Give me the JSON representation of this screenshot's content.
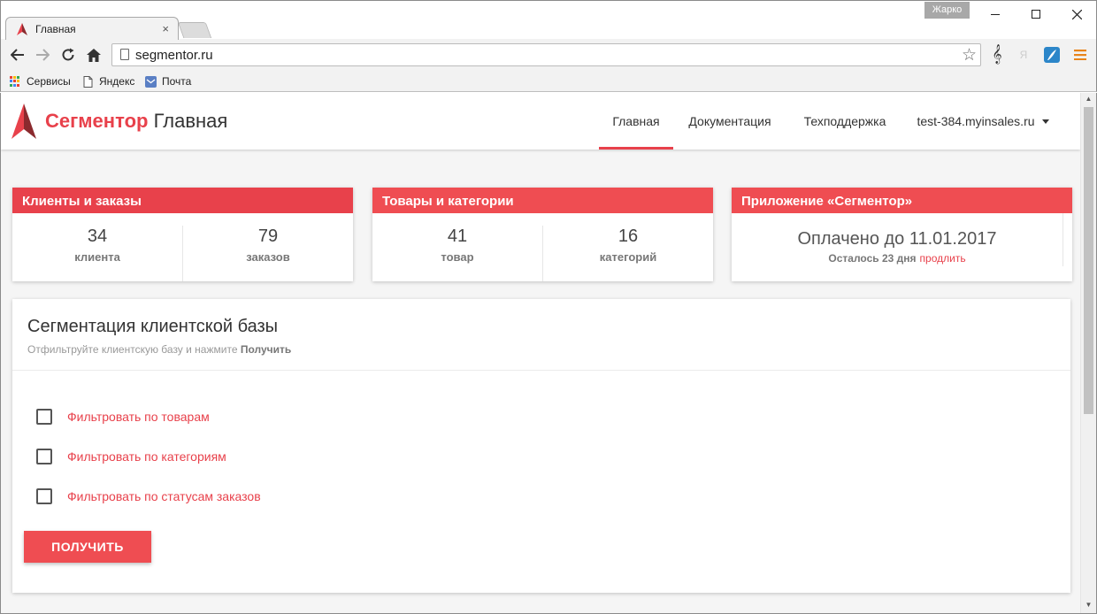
{
  "window": {
    "user_badge": "Жарко"
  },
  "tab": {
    "title": "Главная",
    "close_glyph": "×"
  },
  "omnibox": {
    "url": "segmentor.ru"
  },
  "bookmarks": [
    {
      "label": "Сервисы",
      "icon": "apps-icon"
    },
    {
      "label": "Яндекс",
      "icon": "page-icon"
    },
    {
      "label": "Почта",
      "icon": "mail-icon"
    }
  ],
  "header": {
    "brand_accent": "Сегментор",
    "brand_rest": "Главная",
    "nav": [
      "Главная",
      "Документация",
      "Техподдержка"
    ],
    "account": "test-384.myinsales.ru"
  },
  "cards": {
    "clients": {
      "title": "Клиенты и заказы",
      "stats": [
        {
          "value": "34",
          "label": "клиента"
        },
        {
          "value": "79",
          "label": "заказов"
        }
      ]
    },
    "products": {
      "title": "Товары и категории",
      "stats": [
        {
          "value": "41",
          "label": "товар"
        },
        {
          "value": "16",
          "label": "категорий"
        }
      ]
    },
    "app": {
      "title": "Приложение «Сегментор»",
      "paid_until": "Оплачено до 11.01.2017",
      "remaining": "Осталось 23 дня",
      "extend_link": "продлить"
    }
  },
  "segmentation": {
    "title": "Сегментация клиентской базы",
    "subtitle_prefix": "Отфильтруйте клиентскую базу и нажмите",
    "subtitle_bold": "Получить",
    "filters": [
      "Фильтровать по товарам",
      "Фильтровать по категориям",
      "Фильтровать по статусам заказов"
    ],
    "submit_label": "ПОЛУЧИТЬ"
  },
  "colors": {
    "accent": "#e8414b",
    "card_header": "#ef4d52"
  }
}
